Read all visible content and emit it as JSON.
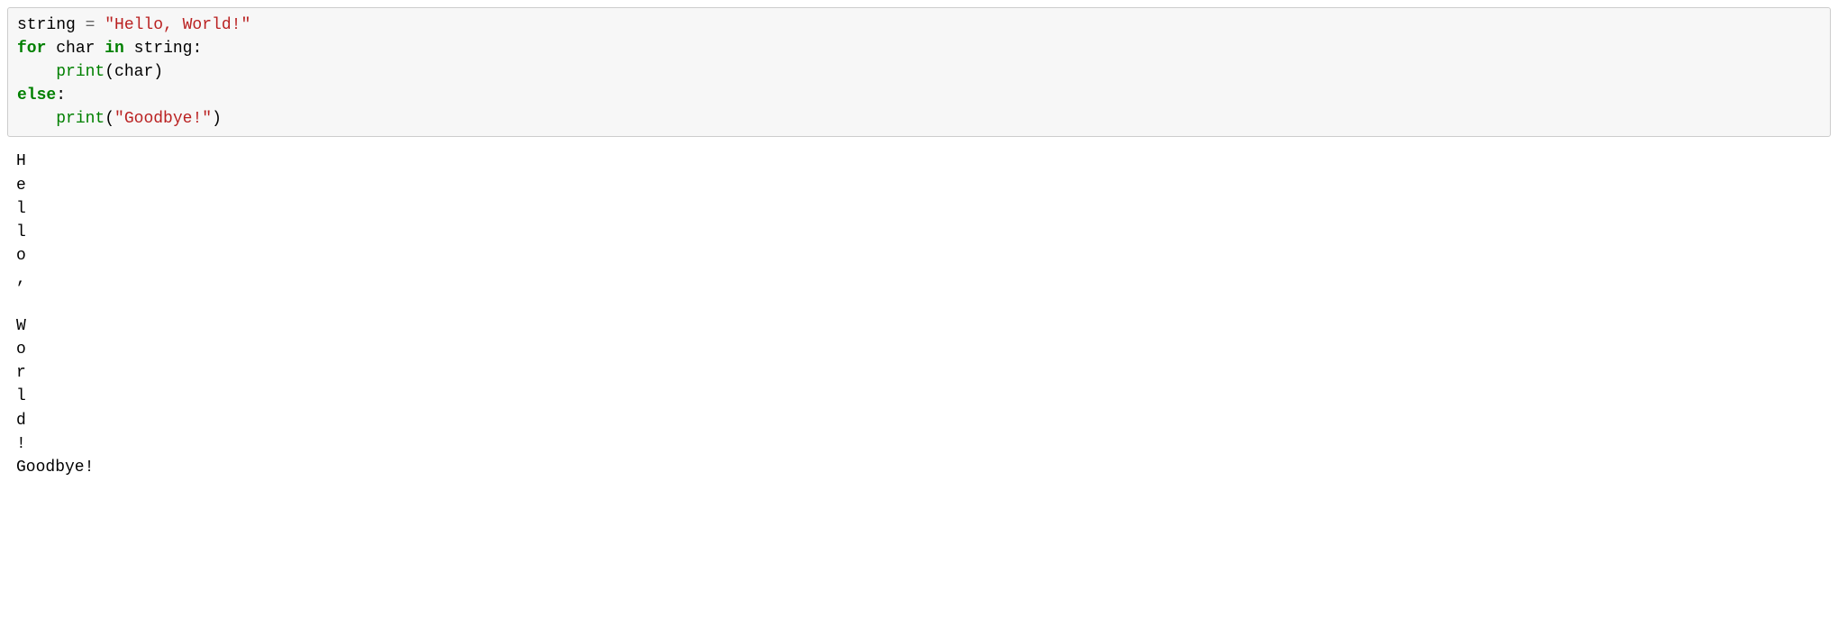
{
  "code": {
    "line1": {
      "varName": "string",
      "assign": " = ",
      "stringLit": "\"Hello, World!\""
    },
    "line2": {
      "forKw": "for",
      "sp1": " ",
      "iterVar": "char",
      "sp2": " ",
      "inKw": "in",
      "sp3": " ",
      "seq": "string",
      "colon": ":"
    },
    "line3": {
      "indent": "    ",
      "printFn": "print",
      "open": "(",
      "arg": "char",
      "close": ")"
    },
    "line4": {
      "elseKw": "else",
      "colon": ":"
    },
    "line5": {
      "indent": "    ",
      "printFn": "print",
      "open": "(",
      "arg": "\"Goodbye!\"",
      "close": ")"
    }
  },
  "output": "H\ne\nl\nl\no\n,\n \nW\no\nr\nl\nd\n!\nGoodbye!"
}
